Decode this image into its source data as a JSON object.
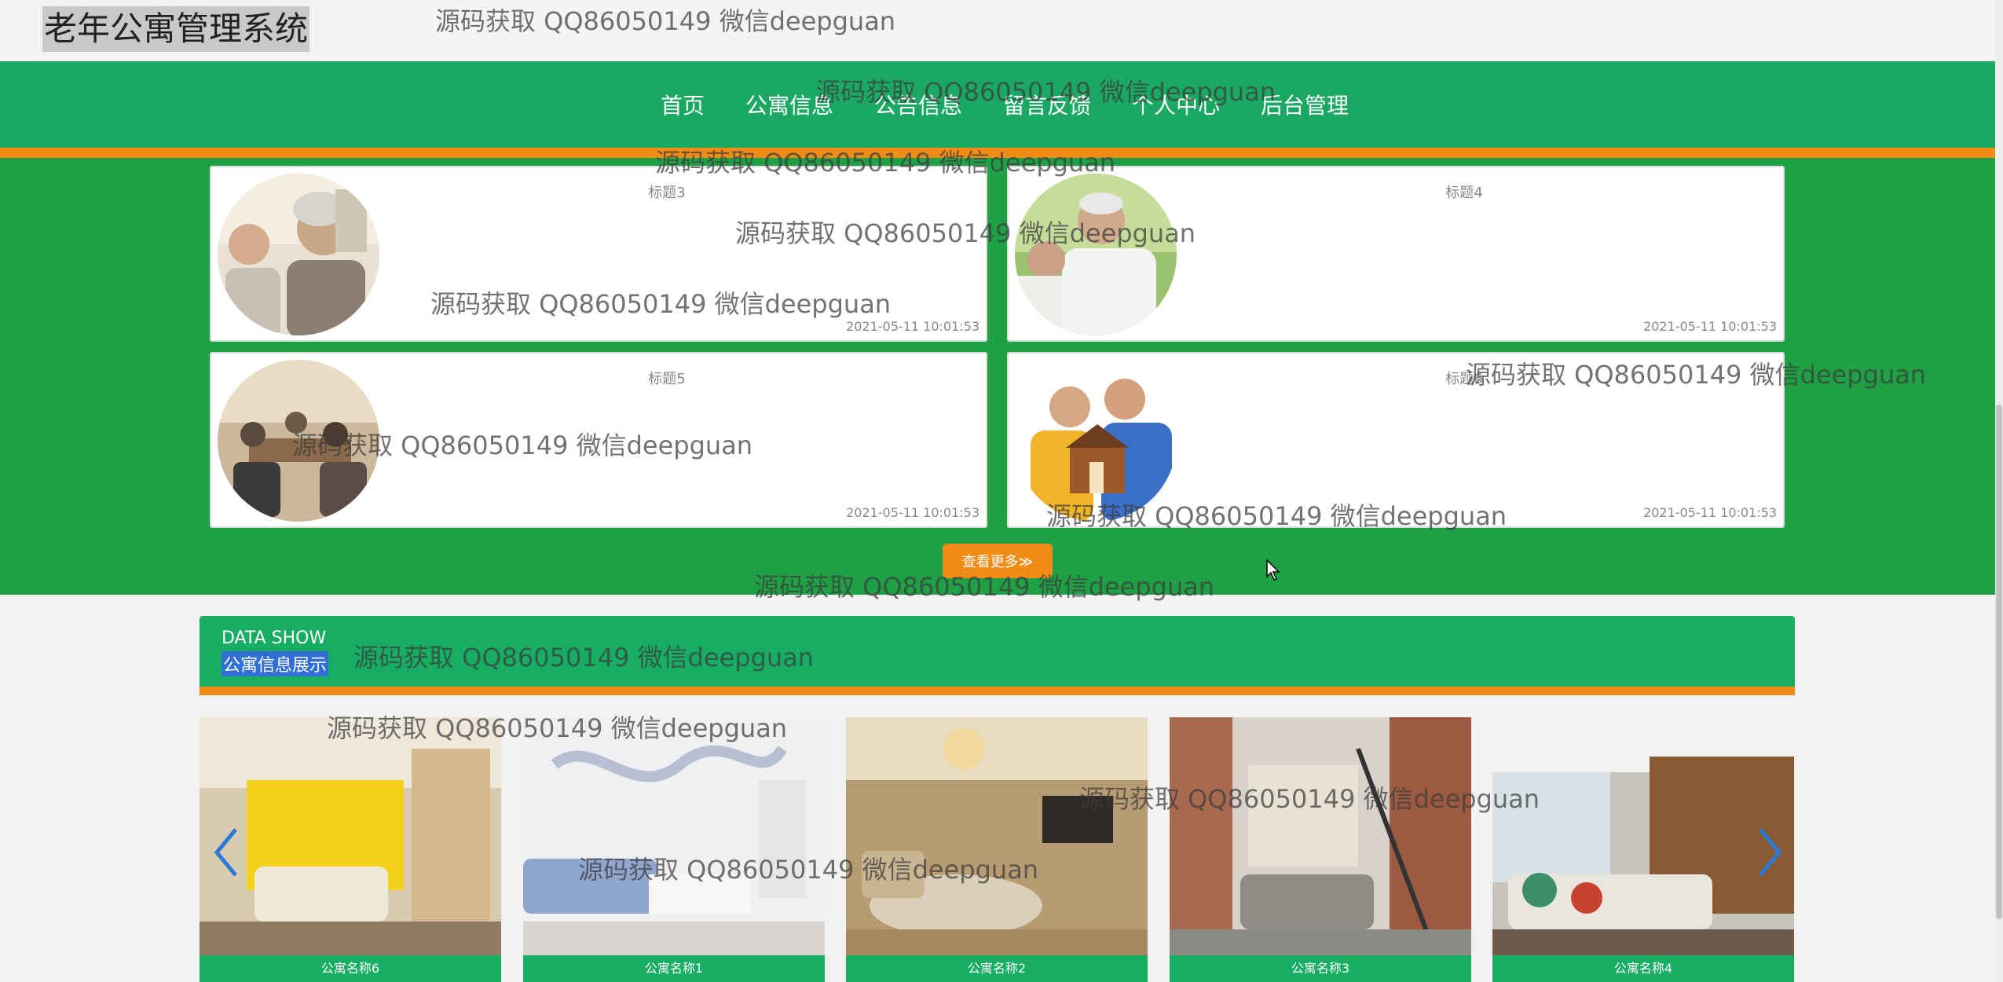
{
  "site": {
    "title": "老年公寓管理系统"
  },
  "nav": {
    "items": [
      "首页",
      "公寓信息",
      "公告信息",
      "留言反馈",
      "个人中心",
      "后台管理"
    ]
  },
  "news": {
    "cards": [
      {
        "title": "标题3",
        "date": "2021-05-11 10:01:53"
      },
      {
        "title": "标题4",
        "date": "2021-05-11 10:01:53"
      },
      {
        "title": "标题5",
        "date": "2021-05-11 10:01:53"
      },
      {
        "title": "标题6",
        "date": "2021-05-11 10:01:53"
      }
    ],
    "more_label": "查看更多≫"
  },
  "showcase": {
    "title_en": "DATA SHOW",
    "title_zh": "公寓信息展示",
    "items": [
      {
        "label": "公寓名称6"
      },
      {
        "label": "公寓名称1"
      },
      {
        "label": "公寓名称2"
      },
      {
        "label": "公寓名称3"
      },
      {
        "label": "公寓名称4"
      }
    ]
  },
  "watermark": "源码获取 QQ86050149 微信deepguan",
  "colors": {
    "nav_green": "#1aa862",
    "section_green": "#1fa045",
    "orange": "#f08c16",
    "highlight": "#2f6fd6"
  },
  "icons": {
    "prev": "chevron-left-icon",
    "next": "chevron-right-icon"
  }
}
